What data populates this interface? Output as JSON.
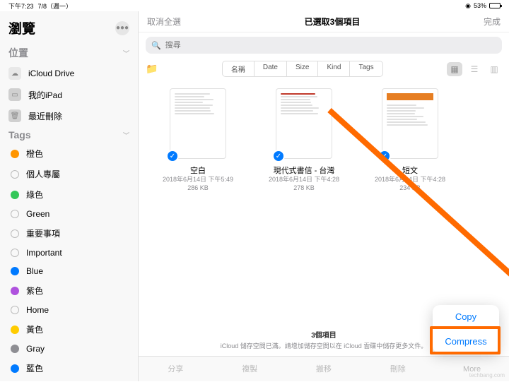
{
  "status": {
    "time": "下午7:23",
    "date": "7/8（週一）",
    "battery": "53%"
  },
  "sidebar": {
    "title": "瀏覽",
    "locations_label": "位置",
    "tags_label": "Tags",
    "items": [
      {
        "label": "iCloud Drive"
      },
      {
        "label": "我的iPad"
      },
      {
        "label": "最近刪除"
      }
    ],
    "tags": [
      {
        "label": "橙色",
        "color": "#ff9500"
      },
      {
        "label": "個人專屬",
        "circle": true
      },
      {
        "label": "綠色",
        "color": "#34c759"
      },
      {
        "label": "Green",
        "circle": true
      },
      {
        "label": "重要事項",
        "circle": true
      },
      {
        "label": "Important",
        "circle": true
      },
      {
        "label": "Blue",
        "color": "#007aff"
      },
      {
        "label": "紫色",
        "color": "#af52de"
      },
      {
        "label": "Home",
        "circle": true
      },
      {
        "label": "黃色",
        "color": "#ffcc00"
      },
      {
        "label": "Gray",
        "color": "#8e8e93"
      },
      {
        "label": "藍色",
        "color": "#007aff"
      }
    ]
  },
  "top": {
    "deselect": "取消全選",
    "title": "已選取3個項目",
    "done": "完成"
  },
  "search": {
    "placeholder": "搜尋"
  },
  "sort": {
    "name": "名稱",
    "date": "Date",
    "size": "Size",
    "kind": "Kind",
    "tags": "Tags"
  },
  "files": [
    {
      "name": "空白",
      "meta1": "2018年6月14日 下午5:49",
      "meta2": "286 KB",
      "accent": "#3478f6"
    },
    {
      "name": "現代式書信 - 台灣",
      "meta1": "2018年6月14日 下午4:28",
      "meta2": "278 KB",
      "accent": "#c0392b"
    },
    {
      "name": "短文",
      "meta1": "2018年6月14日 下午4:28",
      "meta2": "234 KB",
      "accent": "#e67e22"
    }
  ],
  "footer": {
    "count": "3個項目",
    "msg": "iCloud 儲存空間已滿。請增加儲存空間以在 iCloud 雲碟中儲存更多文件。"
  },
  "actions": {
    "share": "分享",
    "copy_cn": "複製",
    "move": "搬移",
    "delete": "刪除",
    "more": "More"
  },
  "popup": {
    "copy": "Copy",
    "compress": "Compress"
  },
  "watermark": "techbang.com"
}
